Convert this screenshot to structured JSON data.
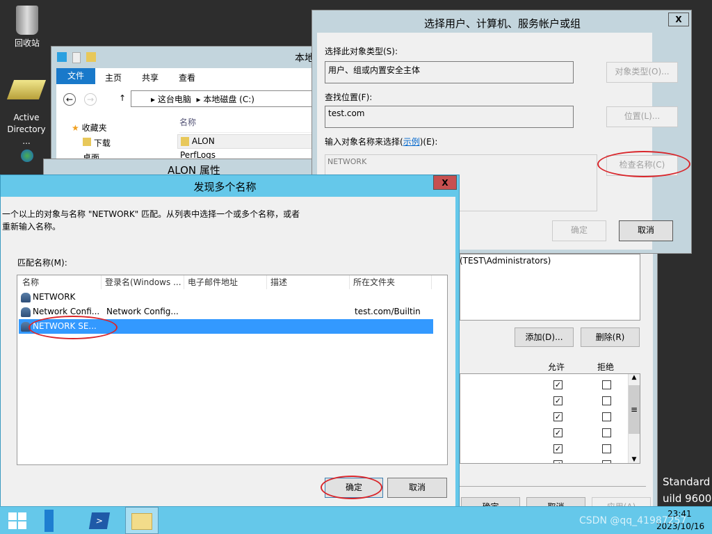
{
  "desktop": {
    "icons": [
      {
        "label": "回收站"
      },
      {
        "label": "Active Directory ..."
      }
    ],
    "watermark_lines": [
      "Standard",
      "uild 9600"
    ]
  },
  "explorer": {
    "title": "本地",
    "ribbon_tabs": [
      "文件",
      "主页",
      "共享",
      "查看"
    ],
    "breadcrumb": [
      "这台电脑",
      "本地磁盘 (C:)"
    ],
    "nav": [
      "收藏夹",
      "下载",
      "桌面"
    ],
    "column_header": "名称",
    "files": [
      "ALON",
      "PerfLogs"
    ]
  },
  "properties": {
    "title": "ALON 属性",
    "principal": "(TEST\\Administrators)",
    "add_label": "添加(D)...",
    "remove_label": "删除(R)",
    "allow_header": "允许",
    "deny_header": "拒绝",
    "permissions": [
      {
        "allow": true,
        "deny": false
      },
      {
        "allow": true,
        "deny": false
      },
      {
        "allow": true,
        "deny": false
      },
      {
        "allow": true,
        "deny": false
      },
      {
        "allow": true,
        "deny": false
      },
      {
        "allow": true,
        "deny": false
      }
    ],
    "ok_label": "确定",
    "cancel_label": "取消",
    "apply_label": "应用(A)"
  },
  "select_dialog": {
    "title": "选择用户、计算机、服务帐户或组",
    "object_type_label": "选择此对象类型(S):",
    "object_type_value": "用户、组或内置安全主体",
    "object_type_button": "对象类型(O)...",
    "location_label": "查找位置(F):",
    "location_value": "test.com",
    "location_button": "位置(L)...",
    "enter_label_prefix": "输入对象名称来选择(",
    "enter_label_link": "示例",
    "enter_label_suffix": ")(E):",
    "enter_value": "NETWORK",
    "check_names_button": "检查名称(C)",
    "ok_label": "确定",
    "cancel_label": "取消",
    "close_label": "X"
  },
  "multi_dialog": {
    "title": "发现多个名称",
    "close_label": "X",
    "message_line1": "一个以上的对象与名称 \"NETWORK\" 匹配。从列表中选择一个或多个名称，或者",
    "message_line2": "重新输入名称。",
    "list_label": "匹配名称(M):",
    "columns": [
      "名称",
      "登录名(Windows ...",
      "电子邮件地址",
      "描述",
      "所在文件夹"
    ],
    "rows": [
      {
        "name": "NETWORK",
        "login": "",
        "email": "",
        "desc": "",
        "folder": "",
        "selected": false
      },
      {
        "name": "Network Confi...",
        "login": "Network Config...",
        "email": "",
        "desc": "",
        "folder": "test.com/Builtin",
        "selected": false
      },
      {
        "name": "NETWORK SE...",
        "login": "",
        "email": "",
        "desc": "",
        "folder": "",
        "selected": true
      }
    ],
    "ok_label": "确定",
    "cancel_label": "取消"
  },
  "taskbar": {
    "time": "23:41",
    "date": "2023/10/16",
    "watermark": "CSDN @qq_41987257"
  },
  "colors": {
    "accent": "#3399ff",
    "titlebar_active": "#65c8ea",
    "annotation": "#d9262b"
  }
}
